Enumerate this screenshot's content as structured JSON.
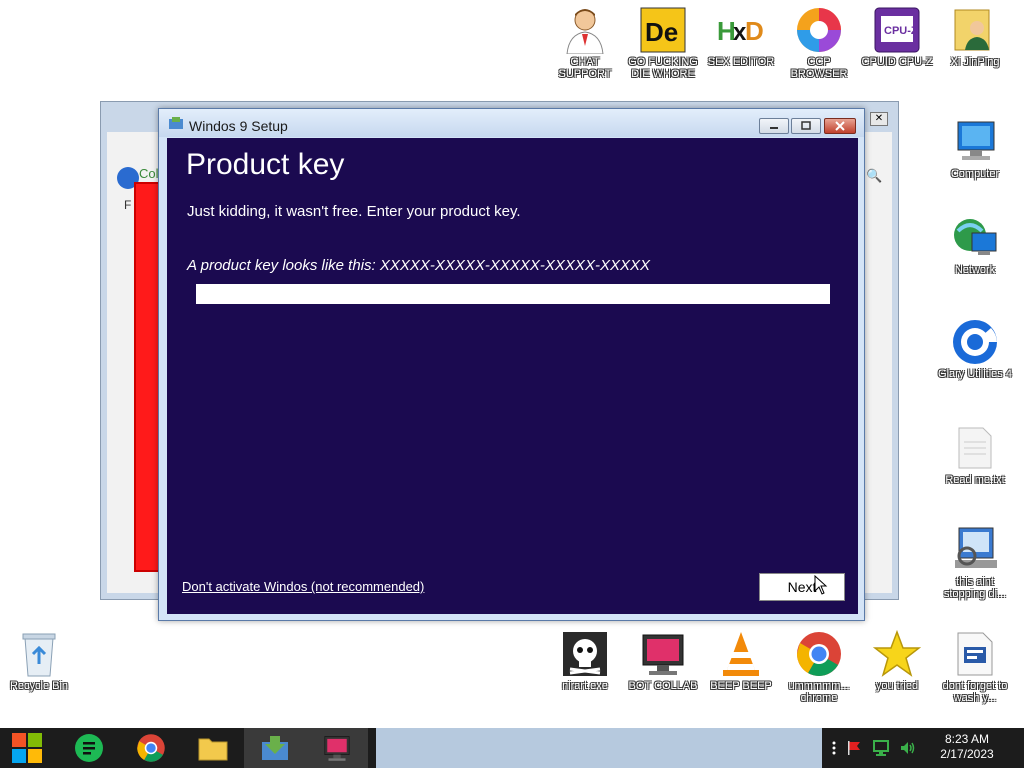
{
  "desktop_icons": {
    "chat_support": "CHAT SUPPORT",
    "die": "GO FUCKING DIE WHORE",
    "sex_editor": "SEX EDITOR",
    "ccp_browser": "CCP BROWSER",
    "cpuz": "CPUID CPU-Z",
    "xi_jinping": "Xi JinPing",
    "computer": "Computer",
    "network": "Network",
    "glary": "Glary Utilities 4",
    "read_me": "Read me.txt",
    "not_stopping": "this aint stopping di...",
    "recycle_bin": "Recycle Bin",
    "nirart": "nirart.exe",
    "bot_collab": "BOT COLLAB",
    "beep_beep": "BEEP BEEP",
    "chrome": "ummmmm... chrome",
    "you_tried": "you tried",
    "wash": "dont forget to wash y..."
  },
  "setup_window": {
    "title": "Windos 9 Setup",
    "heading": "Product key",
    "subtitle": "Just kidding, it wasn't free. Enter your product key.",
    "hint": "A product key looks like this: XXXXX-XXXXX-XXXXX-XXXXX-XXXXX",
    "key_value": "",
    "skip_link": "Don't activate Windos (not recommended)",
    "next_label": "Next"
  },
  "background_window": {
    "partial_title": "Coll",
    "f_letter": "F"
  },
  "taskbar": {
    "time": "8:23 AM",
    "date": "2/17/2023"
  },
  "colors": {
    "setup_bg": "#1b0a50",
    "taskbar_bg": "#1c1c1c",
    "taskbar_empty": "#b6c9de"
  }
}
